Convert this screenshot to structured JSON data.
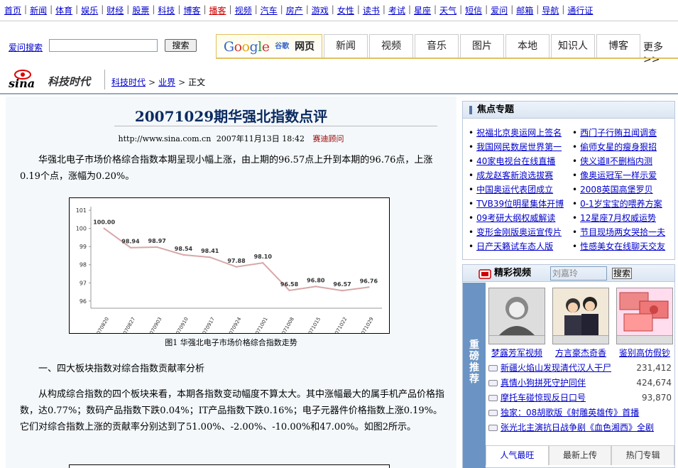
{
  "nav": {
    "items": [
      {
        "label": "首页",
        "hot": false
      },
      {
        "label": "新闻",
        "hot": false
      },
      {
        "label": "体育",
        "hot": false
      },
      {
        "label": "娱乐",
        "hot": false
      },
      {
        "label": "财经",
        "hot": false
      },
      {
        "label": "股票",
        "hot": false
      },
      {
        "label": "科技",
        "hot": false
      },
      {
        "label": "博客",
        "hot": false
      },
      {
        "label": "播客",
        "hot": true
      },
      {
        "label": "视频",
        "hot": false
      },
      {
        "label": "汽车",
        "hot": false
      },
      {
        "label": "房产",
        "hot": false
      },
      {
        "label": "游戏",
        "hot": false
      },
      {
        "label": "女性",
        "hot": false
      },
      {
        "label": "读书",
        "hot": false
      },
      {
        "label": "考试",
        "hot": false
      },
      {
        "label": "星座",
        "hot": false
      },
      {
        "label": "天气",
        "hot": false
      },
      {
        "label": "短信",
        "hot": false
      },
      {
        "label": "爱问",
        "hot": false
      },
      {
        "label": "邮箱",
        "hot": false
      },
      {
        "label": "导航",
        "hot": false
      },
      {
        "label": "通行证",
        "hot": false
      }
    ],
    "separator": "|"
  },
  "search": {
    "iask_label": "爱问搜索",
    "input_value": "",
    "button_label": "搜索",
    "google_logo": "Google",
    "google_cn": "谷歌",
    "tabs": [
      "网页",
      "新闻",
      "视频",
      "音乐",
      "图片",
      "本地",
      "知识人",
      "博客"
    ],
    "more_label": "更多>>"
  },
  "brand": {
    "logo_text": "sina",
    "channel": "科技时代",
    "crumbs": [
      "科技时代",
      "业界",
      "正文"
    ],
    "crumb_sep": ">"
  },
  "article": {
    "title": "20071029期华强北指数点评",
    "source_url": "http://www.sina.com.cn",
    "date": "2007年11月13日 18:42",
    "author": "赛迪顾问",
    "p1": "华强北电子市场价格综合指数本期呈现小幅上涨，由上期的96.57点上升到本期的96.76点，上涨0.19个点，涨幅为0.20%。",
    "caption": "图1 华强北电子市场价格综合指数走势",
    "section1": "一、四大板块指数对综合指数贡献率分析",
    "p2": "从构成综合指数的四个板块来看，本期各指数变动幅度不算太大。其中涨幅最大的属手机产品价格指数，达0.77%；数码产品指数下跌0.04%；IT产品指数下跌0.16%；电子元器件价格指数上涨0.19%。它们对综合指数上涨的贡献率分别达到了51.00%、-2.00%、-10.00%和47.00%。如图2所示。"
  },
  "chart_data": {
    "type": "line",
    "categories": [
      "070820",
      "070827",
      "070903",
      "070910",
      "070917",
      "070924",
      "071001",
      "071008",
      "071015",
      "071022",
      "071029"
    ],
    "values": [
      100.0,
      98.94,
      98.97,
      98.54,
      98.41,
      97.88,
      98.1,
      96.58,
      96.8,
      96.57,
      96.76
    ],
    "value_labels": [
      "100.00",
      "98.94",
      "98.97",
      "98.54",
      "98.41",
      "97.88",
      "98.10",
      "96.58",
      "96.80",
      "96.57",
      "96.76"
    ],
    "yticks": [
      "101",
      "100",
      "99",
      "98",
      "97",
      "96"
    ],
    "ylim": [
      95.6,
      101.2
    ],
    "color": "#d8a7a7",
    "title": "",
    "xlabel": "",
    "ylabel": "",
    "grid": false
  },
  "focus": {
    "title": "焦点专题",
    "left": [
      "祝福北京奥运网上签名",
      "我国网民数居世界第一",
      "40家电视台在线直播",
      "成龙赵客新浪选拔赛",
      "中国奥运代表团成立",
      "TVB39位明星集体开博",
      "09考研大纲权威解读",
      "变形金刚版奥运宣传片",
      "日产天籁试车态人版"
    ],
    "right": [
      "西门子行贿丑闻调查",
      "偷师女星的瘦身狠招",
      "侠义道Ⅱ不删档内测",
      "像奥运冠军一样示爱",
      "2008英国高堡罗贝",
      "0-1岁宝宝的喂养方案",
      "12星座7月权威运势",
      "节目现场两女哭拾一夫",
      "性感美女在线聊天交友"
    ]
  },
  "video": {
    "title": "精彩视频",
    "search_placeholder": "刘嘉玲",
    "search_button": "搜索",
    "rec_label": "重磅推荐",
    "thumbs": [
      "梦露芳军视频",
      "方言豪杰奇香",
      "鉴别高仿假钞"
    ],
    "list": [
      {
        "text": "新疆火焰山发现清代汉人干尸",
        "count": "231,412"
      },
      {
        "text": "真情小狗拼死守护同伴",
        "count": "424,674"
      },
      {
        "text": "摩托车碰惊现反日口号",
        "count": "93,870"
      },
      {
        "text": "独家：08胡歌版《射雕英雄传》首播",
        "count": ""
      },
      {
        "text": "张光北主演抗日战争剧《血色湘西》全剧",
        "count": ""
      }
    ],
    "bottom_tabs": [
      "人气最旺",
      "最新上传",
      "热门专辑"
    ]
  }
}
